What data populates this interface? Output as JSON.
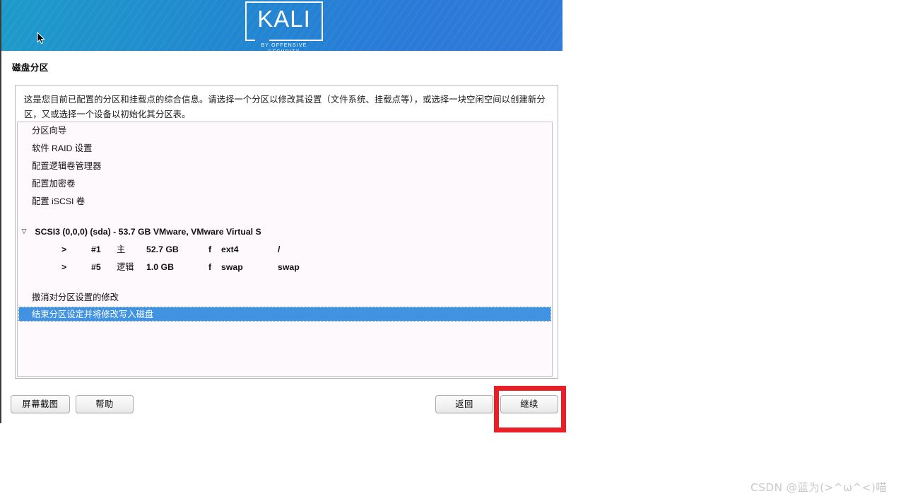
{
  "banner": {
    "logo_word": "KALI",
    "logo_tagline": "BY OFFENSIVE SECURITY",
    "gradient_start": "#1e9bc9",
    "gradient_end": "#2f7ada"
  },
  "page_title": "磁盘分区",
  "description": "这是您目前已配置的分区和挂载点的综合信息。请选择一个分区以修改其设置（文件系统、挂载点等），或选择一块空闲空间以创建新分区，又或选择一个设备以初始化其分区表。",
  "partition_list": {
    "actions": [
      {
        "label": "分区向导"
      },
      {
        "label": "软件 RAID 设置"
      },
      {
        "label": "配置逻辑卷管理器"
      },
      {
        "label": "配置加密卷"
      },
      {
        "label": "配置 iSCSI 卷"
      }
    ],
    "disk": {
      "expander": "▽",
      "label": "SCSI3 (0,0,0) (sda) - 53.7 GB VMware, VMware Virtual S",
      "partitions": [
        {
          "arrow": ">",
          "number": "#1",
          "type": "主",
          "size": "52.7 GB",
          "flag": "f",
          "filesystem": "ext4",
          "mountpoint": "/"
        },
        {
          "arrow": ">",
          "number": "#5",
          "type": "逻辑",
          "size": "1.0 GB",
          "flag": "f",
          "filesystem": "swap",
          "mountpoint": "swap"
        }
      ]
    },
    "undo_label": "撤消对分区设置的修改",
    "finish_label": "结束分区设定并将修改写入磁盘",
    "selection_color": "#4192e0",
    "background_color": "#fdf9fd"
  },
  "buttons": {
    "screenshot": "屏幕截图",
    "help": "帮助",
    "back": "返回",
    "continue": "继续"
  },
  "annotation": {
    "target": "继续",
    "color": "#e81f26"
  },
  "watermark": "CSDN @蓝为(>^ω^<)喵"
}
